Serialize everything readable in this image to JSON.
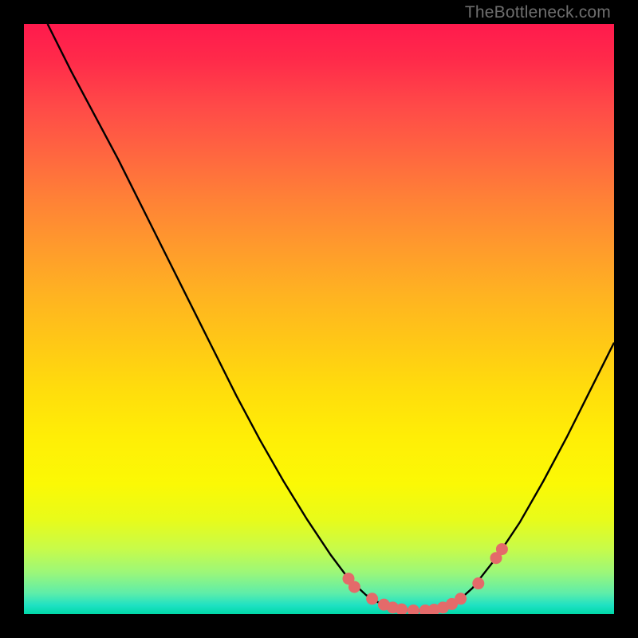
{
  "watermark": "TheBottleneck.com",
  "chart_data": {
    "type": "line",
    "title": "",
    "xlabel": "",
    "ylabel": "",
    "xlim": [
      0,
      100
    ],
    "ylim": [
      0,
      100
    ],
    "grid": false,
    "series": [
      {
        "name": "curve",
        "x": [
          4,
          8,
          12,
          16,
          20,
          24,
          28,
          32,
          36,
          40,
          44,
          48,
          52,
          55,
          58,
          60,
          62,
          64,
          66,
          68,
          70,
          72,
          74,
          76,
          80,
          84,
          88,
          92,
          96,
          100
        ],
        "y": [
          100,
          92,
          84.5,
          77,
          69,
          61,
          53,
          45,
          37,
          29.5,
          22.5,
          16,
          10,
          6,
          3.2,
          2.0,
          1.2,
          0.8,
          0.6,
          0.6,
          0.8,
          1.4,
          2.6,
          4.4,
          9.5,
          15.5,
          22.5,
          30,
          38,
          46
        ]
      }
    ],
    "markers": {
      "name": "highlight-dots",
      "color": "#e46a6a",
      "points": [
        {
          "x": 55,
          "y": 6.0
        },
        {
          "x": 56,
          "y": 4.6
        },
        {
          "x": 59,
          "y": 2.6
        },
        {
          "x": 61,
          "y": 1.6
        },
        {
          "x": 62.5,
          "y": 1.1
        },
        {
          "x": 64,
          "y": 0.8
        },
        {
          "x": 66,
          "y": 0.6
        },
        {
          "x": 68,
          "y": 0.6
        },
        {
          "x": 69.5,
          "y": 0.75
        },
        {
          "x": 71,
          "y": 1.1
        },
        {
          "x": 72.5,
          "y": 1.7
        },
        {
          "x": 74,
          "y": 2.6
        },
        {
          "x": 77,
          "y": 5.2
        },
        {
          "x": 80,
          "y": 9.5
        },
        {
          "x": 81,
          "y": 11.0
        }
      ]
    },
    "background_gradient": {
      "top": "#ff1a4d",
      "mid": "#ffe400",
      "bottom": "#00d9a8"
    }
  }
}
